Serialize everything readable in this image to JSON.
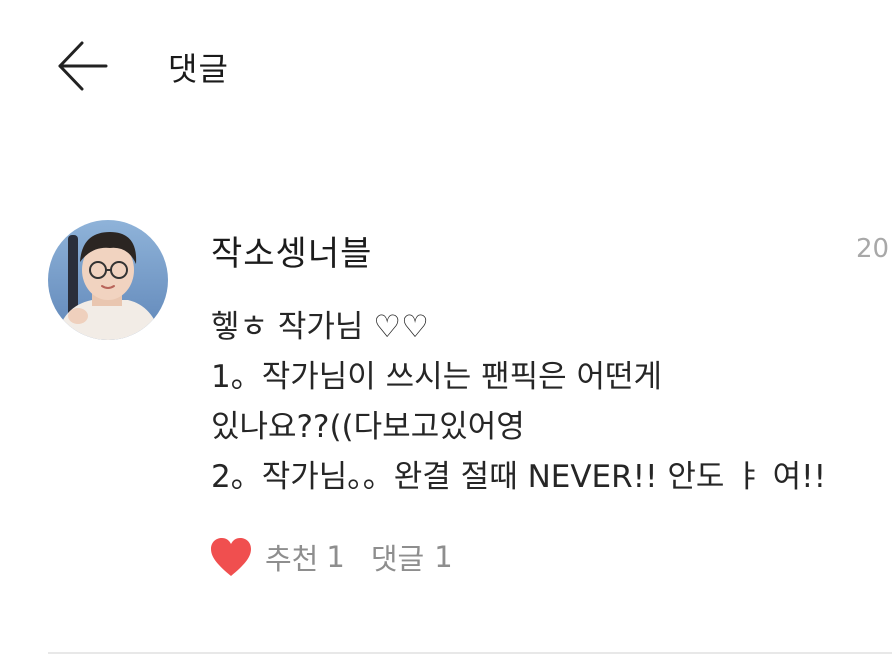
{
  "header": {
    "back_icon": "arrow-left-icon",
    "title": "댓글"
  },
  "comment": {
    "avatar_icon": "user-avatar",
    "username": "작소셍너블",
    "date": "20",
    "lines": [
      "헿ㅎ 작가님 ♡♡",
      "1。작가님이 쓰시는 팬픽은 어떤게",
      "있나요??((다보고있어영",
      "2。작가님。。완결 절때 NEVER!! 안도 ㅑ 여!!"
    ],
    "like": {
      "icon": "heart-icon",
      "color": "#f04f4f",
      "label": "추천",
      "count": "1"
    },
    "reply": {
      "label": "댓글",
      "count": "1"
    }
  }
}
